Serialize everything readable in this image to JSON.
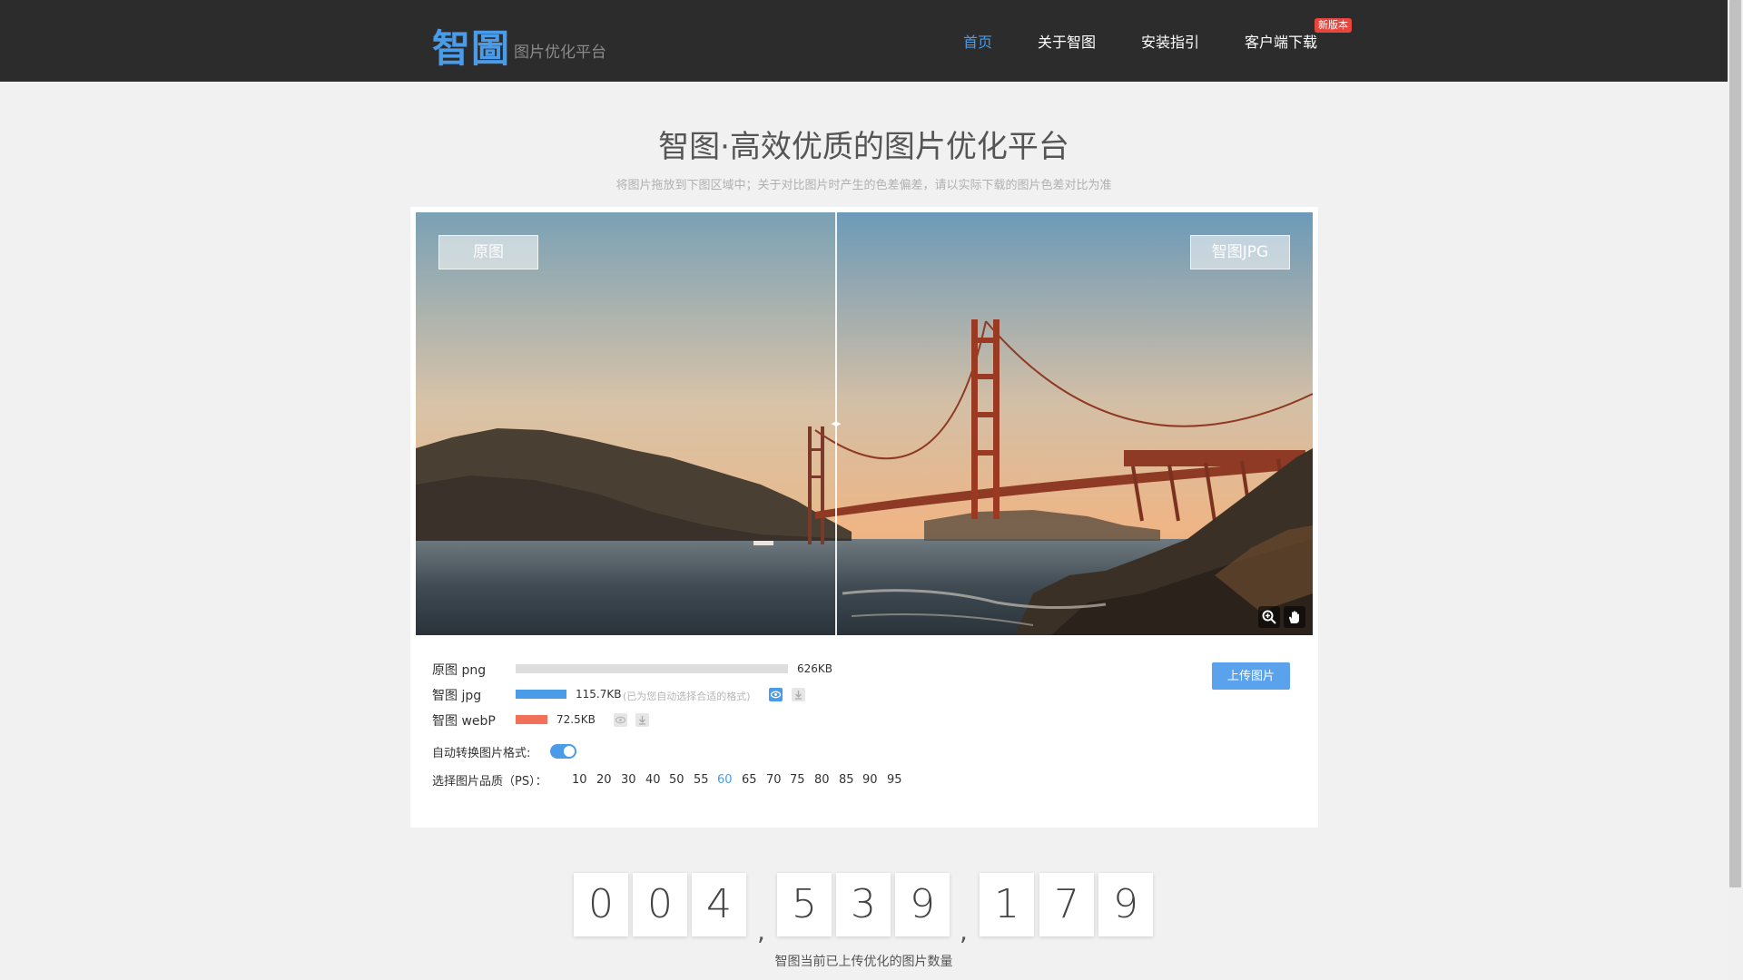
{
  "header": {
    "logo": "智圖",
    "logo_sub": "图片优化平台",
    "nav": [
      {
        "label": "首页",
        "active": true
      },
      {
        "label": "关于智图",
        "active": false
      },
      {
        "label": "安装指引",
        "active": false
      },
      {
        "label": "客户端下载",
        "active": false
      }
    ],
    "badge": "新版本"
  },
  "page": {
    "title": "智图·高效优质的图片优化平台",
    "subtitle": "将图片拖放到下图区域中；关于对比图片时产生的色差偏差，请以实际下载的图片色差对比为准"
  },
  "viewer": {
    "left_label": "原图",
    "right_label": "智图JPG",
    "handle_icon": "split-arrows-icon",
    "tools": [
      "zoom-in-icon",
      "drag-hand-icon"
    ]
  },
  "files": {
    "original": {
      "label": "原图 png",
      "size": "626KB",
      "ratio": 1.0,
      "color": "#dddddd"
    },
    "jpg": {
      "label": "智图 jpg",
      "size": "115.7KB",
      "hint": "(已为您自动选择合适的格式)",
      "ratio": 0.185,
      "color": "#4a9be8"
    },
    "webp": {
      "label": "智图 webP",
      "size": "72.5KB",
      "ratio": 0.116,
      "color": "#f0705a"
    }
  },
  "controls": {
    "upload_label": "上传图片",
    "auto_convert_label": "自动转换图片格式:",
    "auto_convert_on": true,
    "quality_label": "选择图片品质（PS）：",
    "quality_options": [
      "10",
      "20",
      "30",
      "40",
      "50",
      "55",
      "60",
      "65",
      "70",
      "75",
      "80",
      "85",
      "90",
      "95"
    ],
    "quality_selected": "60"
  },
  "counter": {
    "digits": [
      "0",
      "0",
      "4",
      "5",
      "3",
      "9",
      "1",
      "7",
      "9"
    ],
    "separator": ",",
    "caption": "智图当前已上传优化的图片数量"
  }
}
